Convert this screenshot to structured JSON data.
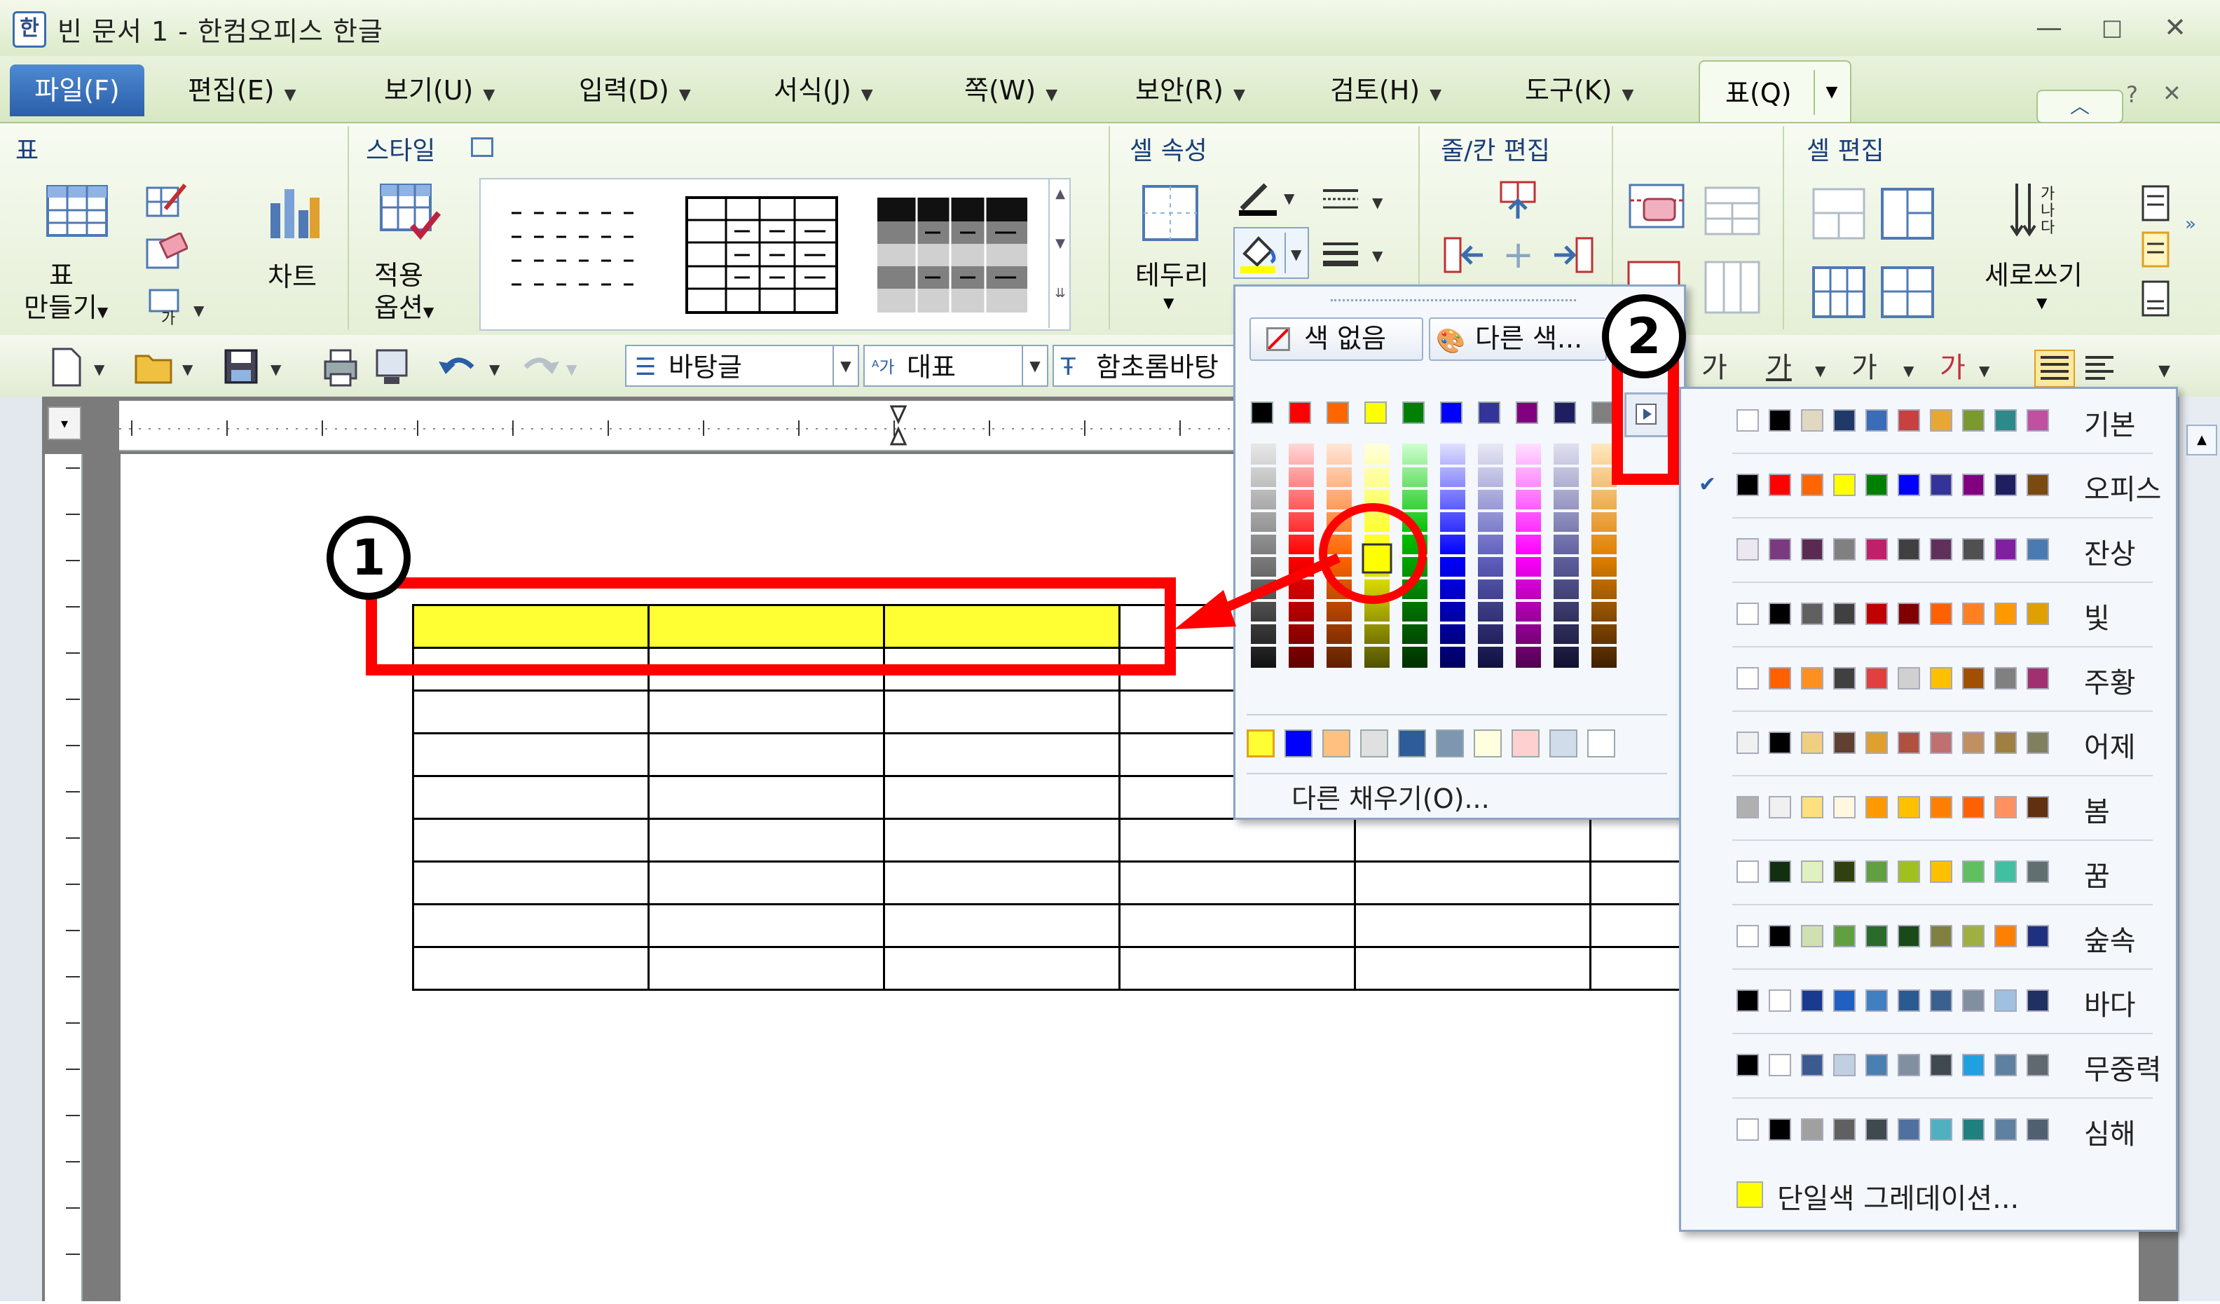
{
  "window": {
    "title": "빈 문서 1 - 한컴오피스 한글",
    "app_icon": "한",
    "help_glyph": "?"
  },
  "menu": {
    "file": "파일(F)",
    "tabs": [
      "편집(E)",
      "보기(U)",
      "입력(D)",
      "서식(J)",
      "쪽(W)",
      "보안(R)",
      "검토(H)",
      "도구(K)"
    ],
    "active": "표(Q)"
  },
  "ribbon": {
    "group_table": {
      "title": "표",
      "make_label_1": "표",
      "make_label_2": "만들기",
      "chart": "차트"
    },
    "group_style": {
      "title": "스타일",
      "apply_1": "적용",
      "apply_2": "옵션"
    },
    "group_cell": {
      "title": "셀 속성",
      "border": "테두리"
    },
    "group_rowcol": {
      "title": "줄/칸 편집"
    },
    "group_celledit": {
      "title": "셀 편집",
      "vertical": "세로쓰기"
    }
  },
  "toolbar": {
    "style_combo": "바탕글",
    "font_lang": "대표",
    "font_name": "함초롬바탕"
  },
  "color_popup": {
    "no_color": "색 없음",
    "other_color": "다른 색...",
    "other_fill": "다른 채우기(O)...",
    "top_row": [
      "#000000",
      "#ff0000",
      "#ff6600",
      "#ffff00",
      "#008000",
      "#0000ff",
      "#333399",
      "#800080",
      "#1f1f5f",
      "#808080"
    ],
    "recent": [
      "#ffff33",
      "#0000ff",
      "#ffc080",
      "#e0e0e0",
      "#2e5c9a",
      "#7f96b0",
      "#ffffe0",
      "#ffd0d0",
      "#d0dcea",
      "#ffffff"
    ]
  },
  "palettes": [
    {
      "name": "기본",
      "colors": [
        "#ffffff",
        "#000000",
        "#e0d8c0",
        "#1f3a68",
        "#3b6cb8",
        "#c94040",
        "#e6a830",
        "#7a9a2e",
        "#2e8a8a",
        "#c050a0"
      ]
    },
    {
      "name": "오피스",
      "colors": [
        "#000000",
        "#ff0000",
        "#ff6600",
        "#ffff00",
        "#008000",
        "#0000ff",
        "#333399",
        "#800080",
        "#1f1f5f",
        "#7a4a10"
      ]
    },
    {
      "name": "잔상",
      "colors": [
        "#ece8f0",
        "#7a3a80",
        "#5a2a50",
        "#808080",
        "#c0206a",
        "#404040",
        "#60305a",
        "#505050",
        "#8020a0",
        "#4a7ab0"
      ]
    },
    {
      "name": "빛",
      "colors": [
        "#ffffff",
        "#000000",
        "#606060",
        "#404040",
        "#c00000",
        "#800000",
        "#ff6000",
        "#ff8020",
        "#ff9900",
        "#e0a000"
      ]
    },
    {
      "name": "주황",
      "colors": [
        "#ffffff",
        "#ff6000",
        "#ff9020",
        "#404040",
        "#e04040",
        "#d0d0d0",
        "#ffc000",
        "#a05000",
        "#808080",
        "#a03070"
      ]
    },
    {
      "name": "어제",
      "colors": [
        "#f0f0f0",
        "#000000",
        "#f0d080",
        "#604030",
        "#e0a030",
        "#b05040",
        "#c07070",
        "#c09060",
        "#a08040",
        "#808060"
      ]
    },
    {
      "name": "봄",
      "colors": [
        "#b0b0b0",
        "#f0f0f0",
        "#ffe080",
        "#fff8e0",
        "#ff9900",
        "#ffc000",
        "#ff8000",
        "#ff6000",
        "#ff9060",
        "#603010"
      ]
    },
    {
      "name": "꿈",
      "colors": [
        "#ffffff",
        "#103010",
        "#e0f0c0",
        "#304010",
        "#60a040",
        "#a0c020",
        "#ffc000",
        "#60c060",
        "#40c0a0",
        "#607070"
      ]
    },
    {
      "name": "숲속",
      "colors": [
        "#ffffff",
        "#000000",
        "#d0e0b0",
        "#60a040",
        "#2a6a2a",
        "#1a4a1a",
        "#808040",
        "#a0b040",
        "#ff8000",
        "#203080"
      ]
    },
    {
      "name": "바다",
      "colors": [
        "#000000",
        "#ffffff",
        "#1a3a90",
        "#2060c0",
        "#4080c0",
        "#2a5a90",
        "#3a6090",
        "#8090a0",
        "#a0c0e0",
        "#203060"
      ]
    },
    {
      "name": "무중력",
      "colors": [
        "#000000",
        "#ffffff",
        "#3a5a90",
        "#c0d0e0",
        "#4a80b0",
        "#8090a0",
        "#404850",
        "#20a0e0",
        "#6080a0",
        "#606870"
      ]
    },
    {
      "name": "심해",
      "colors": [
        "#ffffff",
        "#000000",
        "#a0a0a0",
        "#606060",
        "#404850",
        "#5070a0",
        "#50b0c0",
        "#208080",
        "#6080a0",
        "#506070"
      ]
    }
  ],
  "gradient_label": "단일색 그레데이션...",
  "annotations": {
    "badge1": "1",
    "badge2": "2"
  }
}
